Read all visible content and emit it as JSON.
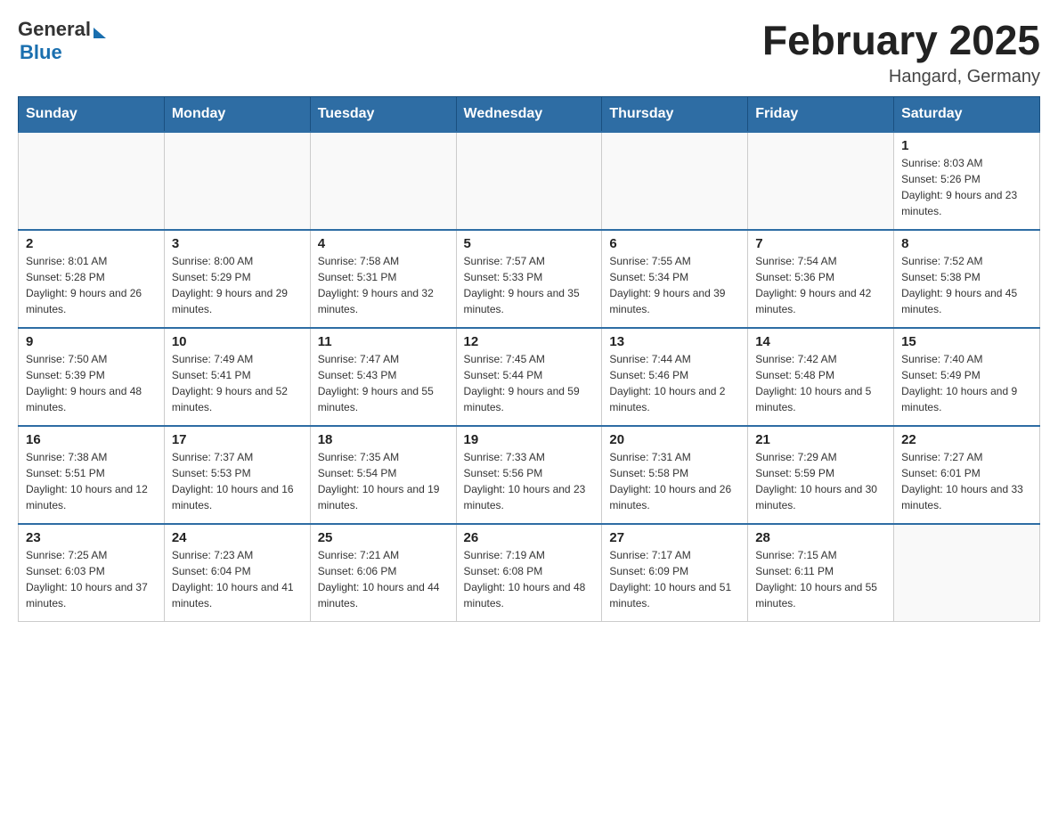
{
  "header": {
    "logo_general": "General",
    "logo_blue": "Blue",
    "month_title": "February 2025",
    "location": "Hangard, Germany"
  },
  "days_of_week": [
    "Sunday",
    "Monday",
    "Tuesday",
    "Wednesday",
    "Thursday",
    "Friday",
    "Saturday"
  ],
  "weeks": [
    [
      {
        "day": "",
        "info": ""
      },
      {
        "day": "",
        "info": ""
      },
      {
        "day": "",
        "info": ""
      },
      {
        "day": "",
        "info": ""
      },
      {
        "day": "",
        "info": ""
      },
      {
        "day": "",
        "info": ""
      },
      {
        "day": "1",
        "info": "Sunrise: 8:03 AM\nSunset: 5:26 PM\nDaylight: 9 hours and 23 minutes."
      }
    ],
    [
      {
        "day": "2",
        "info": "Sunrise: 8:01 AM\nSunset: 5:28 PM\nDaylight: 9 hours and 26 minutes."
      },
      {
        "day": "3",
        "info": "Sunrise: 8:00 AM\nSunset: 5:29 PM\nDaylight: 9 hours and 29 minutes."
      },
      {
        "day": "4",
        "info": "Sunrise: 7:58 AM\nSunset: 5:31 PM\nDaylight: 9 hours and 32 minutes."
      },
      {
        "day": "5",
        "info": "Sunrise: 7:57 AM\nSunset: 5:33 PM\nDaylight: 9 hours and 35 minutes."
      },
      {
        "day": "6",
        "info": "Sunrise: 7:55 AM\nSunset: 5:34 PM\nDaylight: 9 hours and 39 minutes."
      },
      {
        "day": "7",
        "info": "Sunrise: 7:54 AM\nSunset: 5:36 PM\nDaylight: 9 hours and 42 minutes."
      },
      {
        "day": "8",
        "info": "Sunrise: 7:52 AM\nSunset: 5:38 PM\nDaylight: 9 hours and 45 minutes."
      }
    ],
    [
      {
        "day": "9",
        "info": "Sunrise: 7:50 AM\nSunset: 5:39 PM\nDaylight: 9 hours and 48 minutes."
      },
      {
        "day": "10",
        "info": "Sunrise: 7:49 AM\nSunset: 5:41 PM\nDaylight: 9 hours and 52 minutes."
      },
      {
        "day": "11",
        "info": "Sunrise: 7:47 AM\nSunset: 5:43 PM\nDaylight: 9 hours and 55 minutes."
      },
      {
        "day": "12",
        "info": "Sunrise: 7:45 AM\nSunset: 5:44 PM\nDaylight: 9 hours and 59 minutes."
      },
      {
        "day": "13",
        "info": "Sunrise: 7:44 AM\nSunset: 5:46 PM\nDaylight: 10 hours and 2 minutes."
      },
      {
        "day": "14",
        "info": "Sunrise: 7:42 AM\nSunset: 5:48 PM\nDaylight: 10 hours and 5 minutes."
      },
      {
        "day": "15",
        "info": "Sunrise: 7:40 AM\nSunset: 5:49 PM\nDaylight: 10 hours and 9 minutes."
      }
    ],
    [
      {
        "day": "16",
        "info": "Sunrise: 7:38 AM\nSunset: 5:51 PM\nDaylight: 10 hours and 12 minutes."
      },
      {
        "day": "17",
        "info": "Sunrise: 7:37 AM\nSunset: 5:53 PM\nDaylight: 10 hours and 16 minutes."
      },
      {
        "day": "18",
        "info": "Sunrise: 7:35 AM\nSunset: 5:54 PM\nDaylight: 10 hours and 19 minutes."
      },
      {
        "day": "19",
        "info": "Sunrise: 7:33 AM\nSunset: 5:56 PM\nDaylight: 10 hours and 23 minutes."
      },
      {
        "day": "20",
        "info": "Sunrise: 7:31 AM\nSunset: 5:58 PM\nDaylight: 10 hours and 26 minutes."
      },
      {
        "day": "21",
        "info": "Sunrise: 7:29 AM\nSunset: 5:59 PM\nDaylight: 10 hours and 30 minutes."
      },
      {
        "day": "22",
        "info": "Sunrise: 7:27 AM\nSunset: 6:01 PM\nDaylight: 10 hours and 33 minutes."
      }
    ],
    [
      {
        "day": "23",
        "info": "Sunrise: 7:25 AM\nSunset: 6:03 PM\nDaylight: 10 hours and 37 minutes."
      },
      {
        "day": "24",
        "info": "Sunrise: 7:23 AM\nSunset: 6:04 PM\nDaylight: 10 hours and 41 minutes."
      },
      {
        "day": "25",
        "info": "Sunrise: 7:21 AM\nSunset: 6:06 PM\nDaylight: 10 hours and 44 minutes."
      },
      {
        "day": "26",
        "info": "Sunrise: 7:19 AM\nSunset: 6:08 PM\nDaylight: 10 hours and 48 minutes."
      },
      {
        "day": "27",
        "info": "Sunrise: 7:17 AM\nSunset: 6:09 PM\nDaylight: 10 hours and 51 minutes."
      },
      {
        "day": "28",
        "info": "Sunrise: 7:15 AM\nSunset: 6:11 PM\nDaylight: 10 hours and 55 minutes."
      },
      {
        "day": "",
        "info": ""
      }
    ]
  ]
}
